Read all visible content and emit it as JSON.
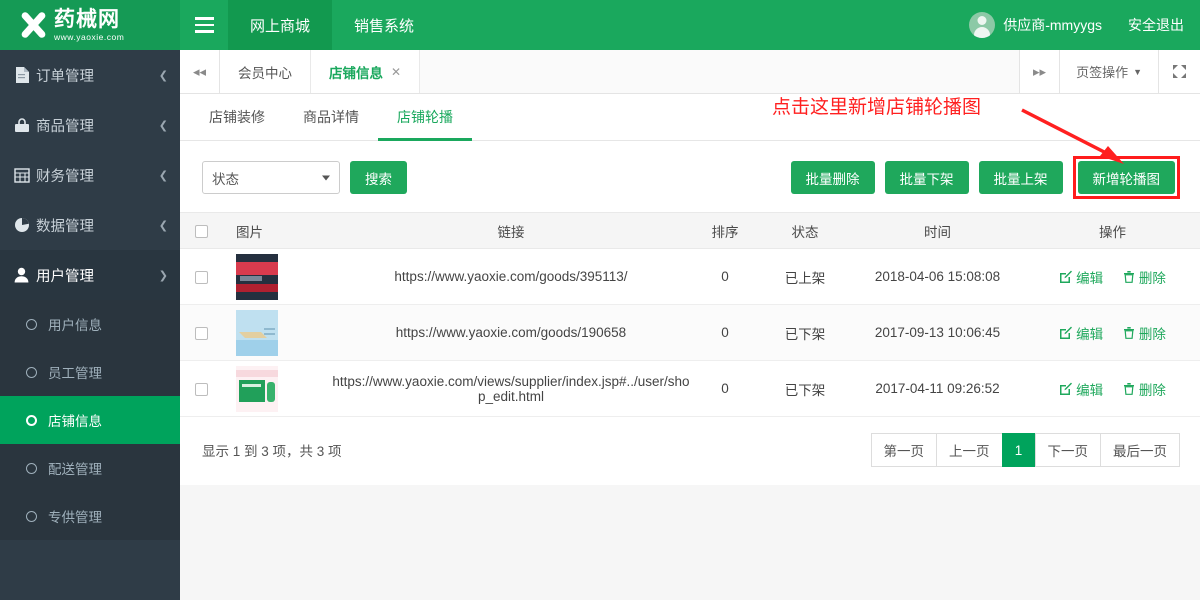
{
  "brand": {
    "name_cn": "药械网",
    "url": "www.yaoxie.com",
    "logo_icon": "x-cross-logo"
  },
  "topbar": {
    "menu_icon": "hamburger-icon",
    "nav": [
      {
        "label": "网上商城",
        "active": true
      },
      {
        "label": "销售系统",
        "active": false
      }
    ],
    "user": "供应商-mmyygs",
    "logout": "安全退出",
    "avatar_icon": "user-avatar-icon",
    "background": "#1aa85d"
  },
  "sidebar": {
    "items": [
      {
        "label": "订单管理",
        "icon": "document-icon",
        "expanded": false
      },
      {
        "label": "商品管理",
        "icon": "bag-icon",
        "expanded": false
      },
      {
        "label": "财务管理",
        "icon": "table-icon",
        "expanded": false
      },
      {
        "label": "数据管理",
        "icon": "pie-chart-icon",
        "expanded": false
      },
      {
        "label": "用户管理",
        "icon": "user-icon",
        "expanded": true
      }
    ],
    "submenu": [
      {
        "label": "用户信息",
        "active": false
      },
      {
        "label": "员工管理",
        "active": false
      },
      {
        "label": "店铺信息",
        "active": true
      },
      {
        "label": "配送管理",
        "active": false
      },
      {
        "label": "专供管理",
        "active": false
      }
    ],
    "background": "#2f3c47",
    "active_color": "#00a35c"
  },
  "tabstrip": {
    "prev_icon": "double-chevron-left-icon",
    "next_icon": "double-chevron-right-icon",
    "tabs": [
      {
        "label": "会员中心",
        "active": false,
        "closable": false
      },
      {
        "label": "店铺信息",
        "active": true,
        "closable": true
      }
    ],
    "close_icon": "close-icon",
    "tools_label": "页签操作",
    "tools_caret": "caret-down-icon",
    "fullscreen_icon": "fullscreen-icon"
  },
  "subtabs": [
    {
      "label": "店铺装修",
      "active": false
    },
    {
      "label": "商品详情",
      "active": false
    },
    {
      "label": "店铺轮播",
      "active": true
    }
  ],
  "toolbar": {
    "status_select": {
      "value": "状态",
      "caret_icon": "caret-down-icon"
    },
    "search_label": "搜索",
    "batch_delete": "批量删除",
    "batch_offshelf": "批量下架",
    "batch_onshelf": "批量上架",
    "add_banner": "新增轮播图",
    "button_color": "#1fa85c",
    "highlight_color": "#ff1c1c"
  },
  "table": {
    "headers": [
      "",
      "图片",
      "链接",
      "排序",
      "状态",
      "时间",
      "操作"
    ],
    "select_all_icon": "checkbox-icon",
    "rows": [
      {
        "checkbox": "checkbox-icon",
        "thumb": "banner-thumbnail-dark",
        "link": "https://www.yaoxie.com/goods/395113/",
        "sort": "0",
        "status": "已上架",
        "time": "2018-04-06 15:08:08",
        "edit": "编辑",
        "delete": "删除"
      },
      {
        "checkbox": "checkbox-icon",
        "thumb": "banner-thumbnail-blue",
        "link": "https://www.yaoxie.com/goods/190658",
        "sort": "0",
        "status": "已下架",
        "time": "2017-09-13 10:06:45",
        "edit": "编辑",
        "delete": "删除"
      },
      {
        "checkbox": "checkbox-icon",
        "thumb": "banner-thumbnail-green",
        "link": "https://www.yaoxie.com/views/supplier/index.jsp#../user/shop_edit.html",
        "sort": "0",
        "status": "已下架",
        "time": "2017-04-11 09:26:52",
        "edit": "编辑",
        "delete": "删除"
      }
    ],
    "edit_icon": "pencil-square-icon",
    "delete_icon": "trash-icon"
  },
  "footer": {
    "info": "显示 1 到 3 项，共 3 项",
    "pagination": [
      {
        "label": "第一页",
        "active": false
      },
      {
        "label": "上一页",
        "active": false
      },
      {
        "label": "1",
        "active": true
      },
      {
        "label": "下一页",
        "active": false
      },
      {
        "label": "最后一页",
        "active": false
      }
    ]
  },
  "annotation": {
    "text": "点击这里新增店铺轮播图",
    "color": "#ff2020",
    "arrow_icon": "red-arrow-icon"
  }
}
